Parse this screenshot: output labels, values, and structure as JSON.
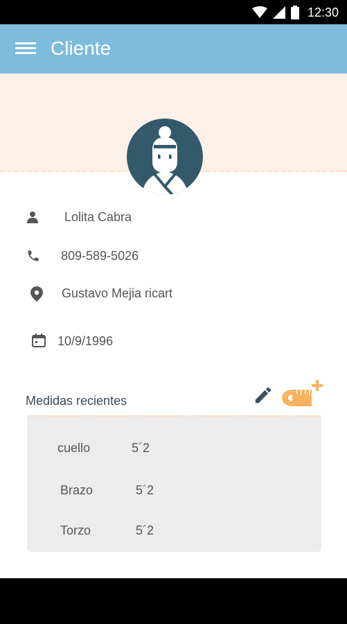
{
  "status_bar": {
    "time": "12:30",
    "icons": [
      "wifi-icon",
      "signal-icon",
      "battery-icon"
    ]
  },
  "app_bar": {
    "title": "Cliente",
    "menu_icon": "menu-icon",
    "color": "#7ebbdd"
  },
  "client": {
    "name": "Lolita Cabra",
    "phone": "809-589-5026",
    "address": "Gustavo Mejia ricart",
    "birthdate": "10/9/1996"
  },
  "measures": {
    "heading": "Medidas recientes",
    "items": [
      {
        "label": "cuello",
        "value": "5´2"
      },
      {
        "label": "Brazo",
        "value": "5´2"
      },
      {
        "label": "Torzo",
        "value": "5´2"
      }
    ]
  },
  "colors": {
    "banner": "#fdf0e6",
    "accent": "#f7b35f",
    "avatar_bg": "#33596b",
    "icon": "#555555"
  }
}
